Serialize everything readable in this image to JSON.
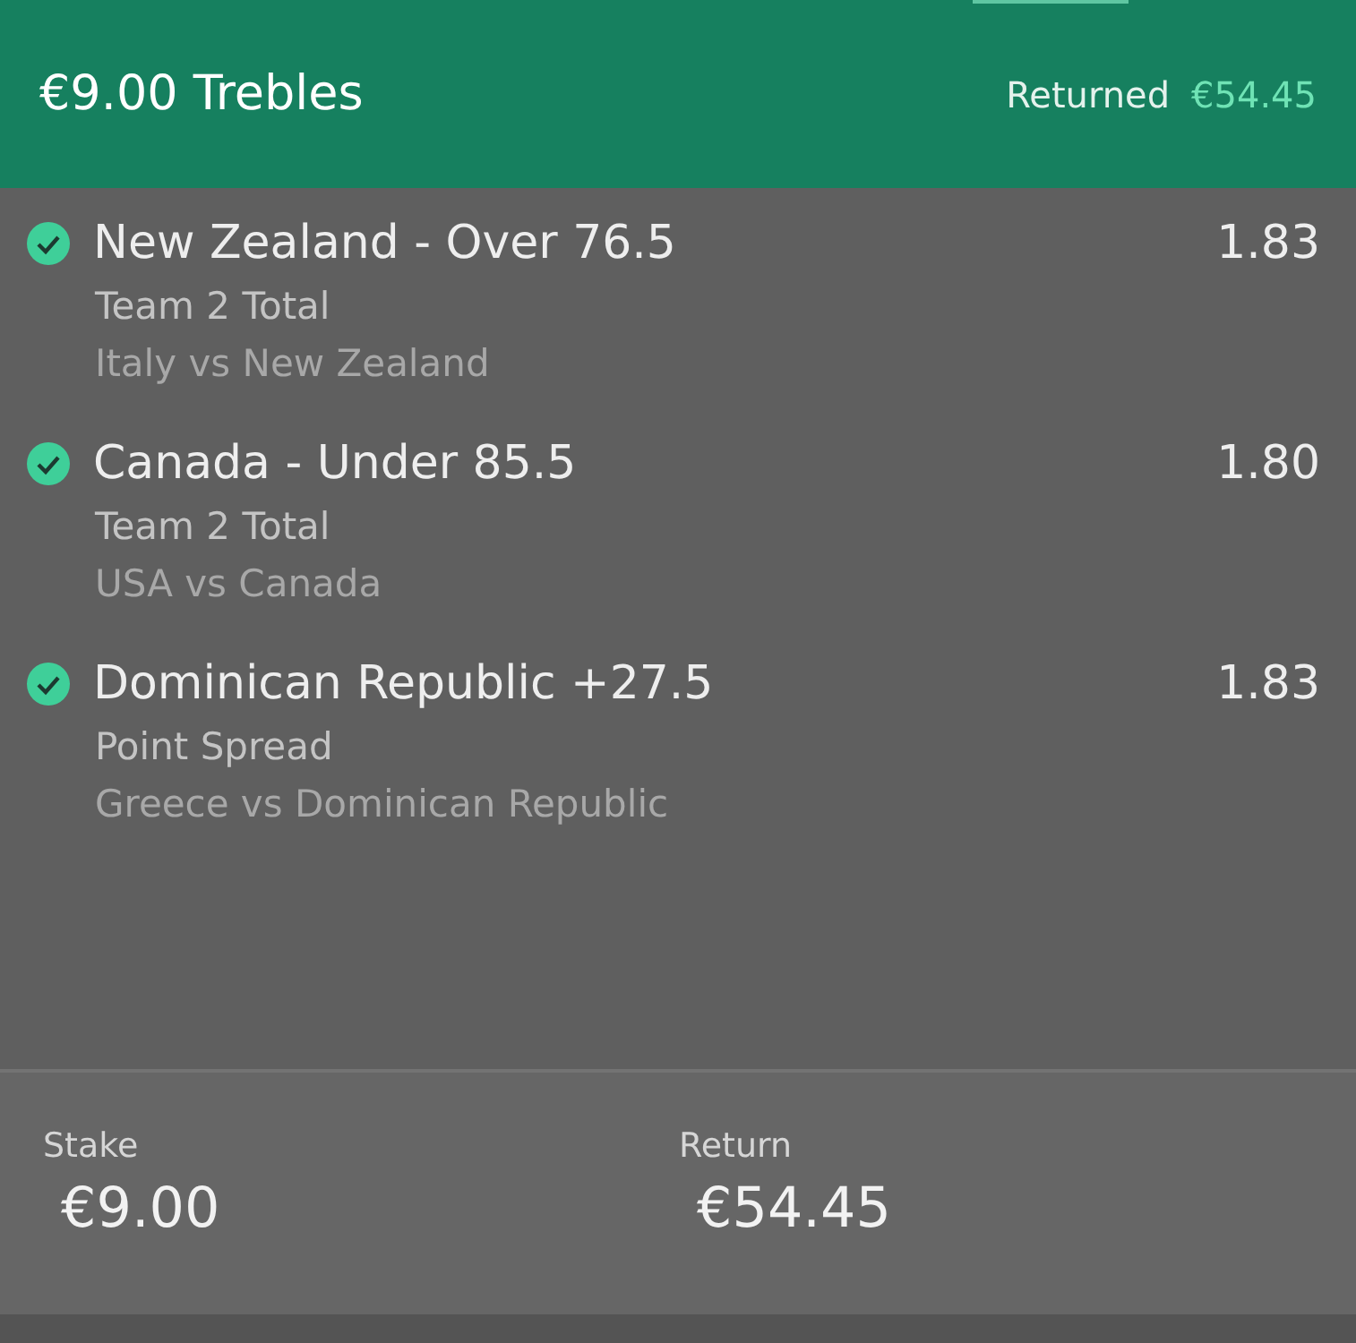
{
  "header": {
    "title": "€9.00 Trebles",
    "returned_label": "Returned",
    "returned_amount": "€54.45"
  },
  "selections": [
    {
      "name": "New Zealand - Over 76.5",
      "odds": "1.83",
      "market": "Team 2 Total",
      "event": "Italy vs New Zealand",
      "won": true
    },
    {
      "name": "Canada - Under 85.5",
      "odds": "1.80",
      "market": "Team 2 Total",
      "event": "USA vs Canada",
      "won": true
    },
    {
      "name": "Dominican Republic +27.5",
      "odds": "1.83",
      "market": "Point Spread",
      "event": "Greece vs Dominican Republic",
      "won": true
    }
  ],
  "summary": {
    "stake_label": "Stake",
    "stake": "€9.00",
    "return_label": "Return",
    "return": "€54.45"
  }
}
